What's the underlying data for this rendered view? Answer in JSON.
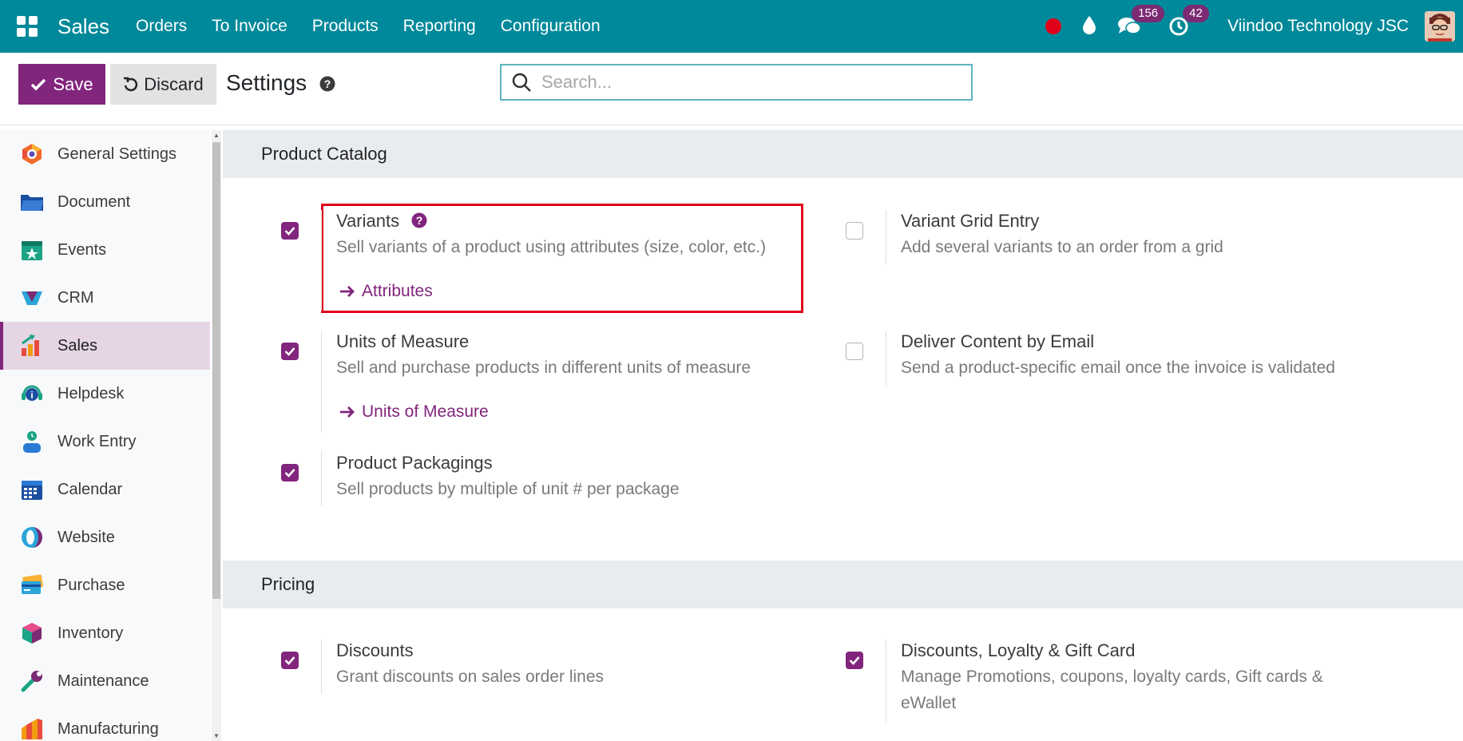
{
  "navbar": {
    "app_name": "Sales",
    "menu": [
      "Orders",
      "To Invoice",
      "Products",
      "Reporting",
      "Configuration"
    ],
    "messages_count": "156",
    "activities_count": "42",
    "company": "Viindoo Technology JSC",
    "bg_color": "#00899a"
  },
  "control": {
    "save_label": "Save",
    "discard_label": "Discard",
    "title": "Settings",
    "search_placeholder": "Search..."
  },
  "sidebar": {
    "items": [
      {
        "label": "General Settings",
        "icon": "general-settings-icon"
      },
      {
        "label": "Document",
        "icon": "folder-icon"
      },
      {
        "label": "Events",
        "icon": "calendar-star-icon"
      },
      {
        "label": "CRM",
        "icon": "crm-icon"
      },
      {
        "label": "Sales",
        "icon": "sales-chart-icon",
        "active": true
      },
      {
        "label": "Helpdesk",
        "icon": "headset-icon"
      },
      {
        "label": "Work Entry",
        "icon": "person-clock-icon"
      },
      {
        "label": "Calendar",
        "icon": "calendar-icon"
      },
      {
        "label": "Website",
        "icon": "website-icon"
      },
      {
        "label": "Purchase",
        "icon": "credit-card-icon"
      },
      {
        "label": "Inventory",
        "icon": "box-icon"
      },
      {
        "label": "Maintenance",
        "icon": "wrench-icon"
      },
      {
        "label": "Manufacturing",
        "icon": "factory-icon"
      }
    ]
  },
  "sections": {
    "catalog": {
      "title": "Product Catalog",
      "variants": {
        "title": "Variants",
        "desc": "Sell variants of a product using attributes (size, color, etc.)",
        "link": "Attributes",
        "checked": true
      },
      "grid": {
        "title": "Variant Grid Entry",
        "desc": "Add several variants to an order from a grid",
        "checked": false
      },
      "uom": {
        "title": "Units of Measure",
        "desc": "Sell and purchase products in different units of measure",
        "link": "Units of Measure",
        "checked": true
      },
      "deliver": {
        "title": "Deliver Content by Email",
        "desc": "Send a product-specific email once the invoice is validated",
        "checked": false
      },
      "packaging": {
        "title": "Product Packagings",
        "desc": "Sell products by multiple of unit # per package",
        "checked": true
      }
    },
    "pricing": {
      "title": "Pricing",
      "discounts": {
        "title": "Discounts",
        "desc": "Grant discounts on sales order lines",
        "checked": true
      },
      "loyalty": {
        "title": "Discounts, Loyalty & Gift Card",
        "desc": "Manage Promotions, coupons, loyalty cards, Gift cards & eWallet",
        "checked": true
      }
    }
  },
  "colors": {
    "accent": "#82257d",
    "highlight": "#e0001a"
  }
}
